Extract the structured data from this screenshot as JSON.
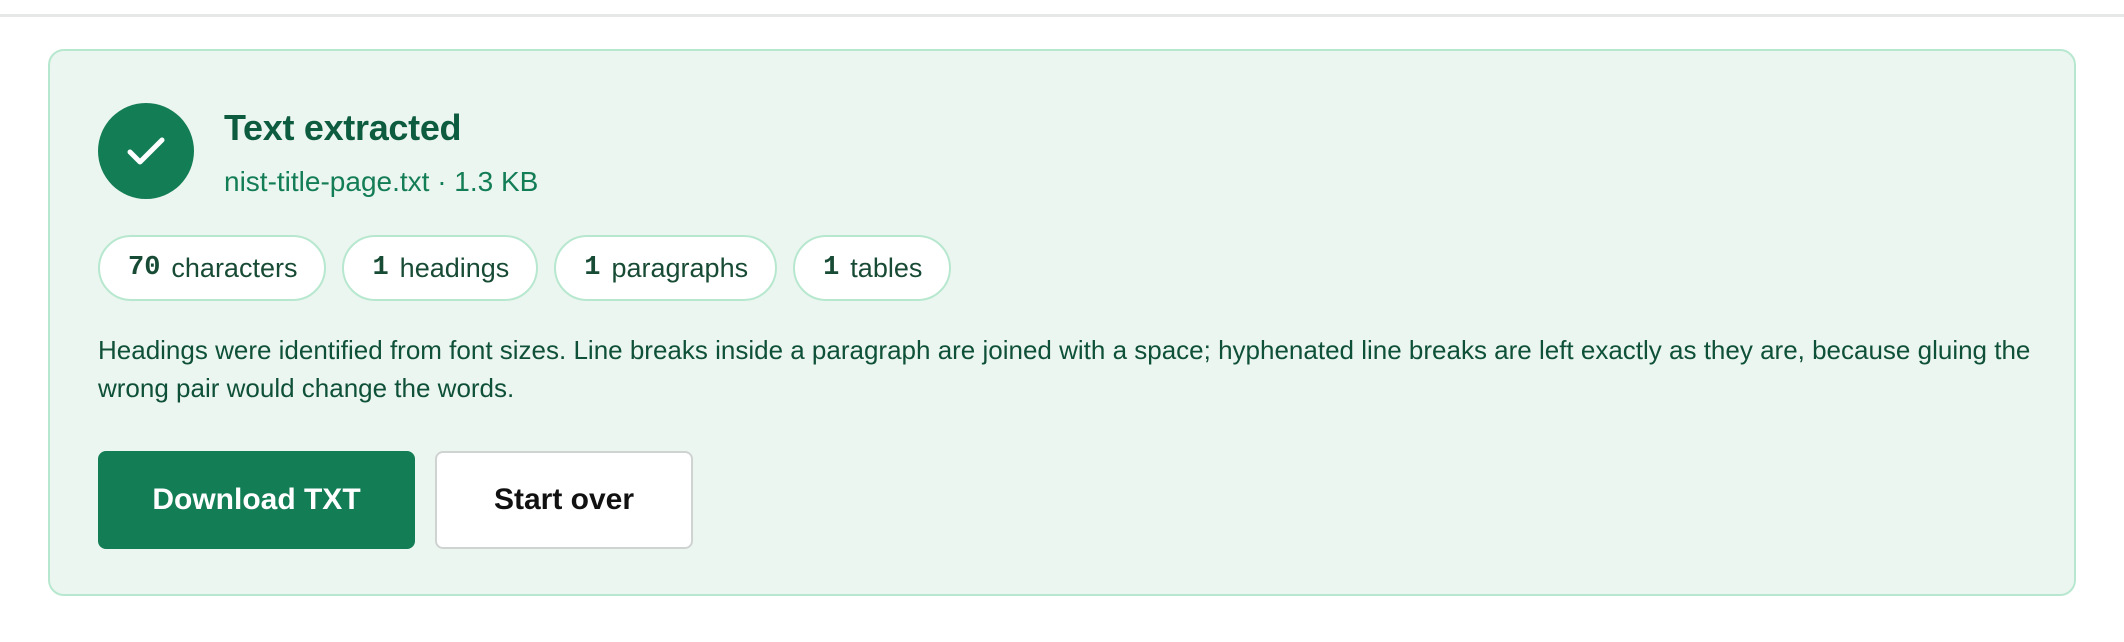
{
  "colors": {
    "accent": "#137d56",
    "card_background": "#ecf6f0",
    "card_border": "#b7e8cf",
    "title_text": "#0d5c3f"
  },
  "result": {
    "icon": "checkmark-icon",
    "title": "Text extracted",
    "file_meta": "nist-title-page.txt · 1.3 KB",
    "stats": [
      {
        "count": "70",
        "label": "characters"
      },
      {
        "count": "1",
        "label": "headings"
      },
      {
        "count": "1",
        "label": "paragraphs"
      },
      {
        "count": "1",
        "label": "tables"
      }
    ],
    "note": "Headings were identified from font sizes. Line breaks inside a paragraph are joined with a space; hyphenated line breaks are left exactly as they are, because gluing the wrong pair would change the words."
  },
  "actions": {
    "download_label": "Download TXT",
    "start_over_label": "Start over"
  }
}
